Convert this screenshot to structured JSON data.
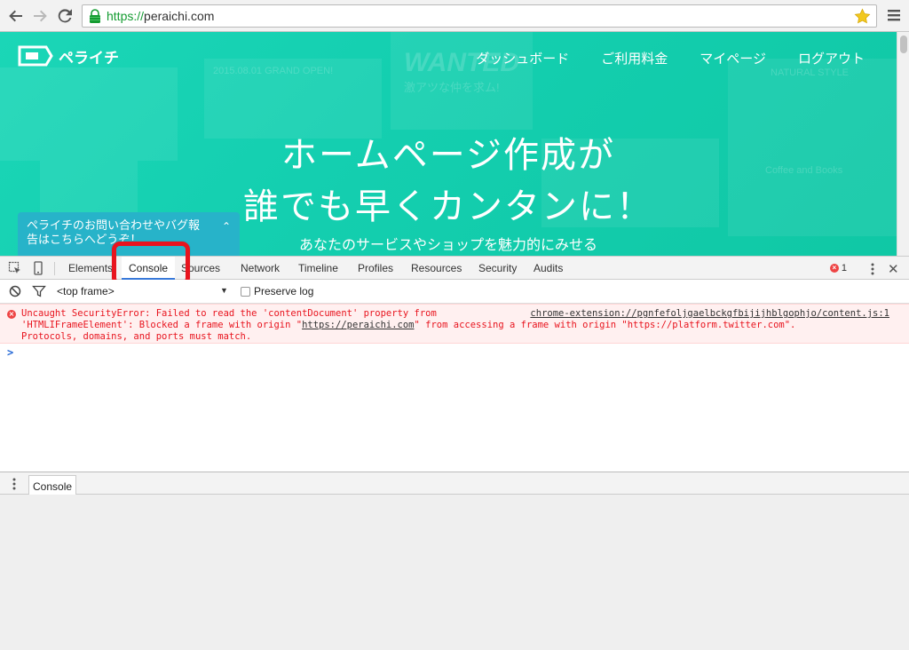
{
  "browser": {
    "url_scheme": "https://",
    "url_host": "peraichi.com"
  },
  "site": {
    "logo_text": "ペライチ",
    "nav": [
      "ダッシュボード",
      "ご利用料金",
      "マイページ",
      "ログアウト"
    ],
    "hero_line1": "ホームページ作成が",
    "hero_line2": "誰でも早くカンタンに！",
    "hero_sub": "あなたのサービスやショップを魅力的にみせる",
    "help_line1": "ペライチのお問い合わせやバグ報",
    "help_line2": "告はこちらへどうぞ！",
    "bg_text": [
      "2015.08.01 GRAND OPEN!",
      "WANTED",
      "激アツな仲を求ム!",
      "NATURAL STYLE",
      "Coffee and Books"
    ]
  },
  "devtools": {
    "tabs": [
      "Elements",
      "Console",
      "Sources",
      "Network",
      "Timeline",
      "Profiles",
      "Resources",
      "Security",
      "Audits"
    ],
    "active_tab": "Console",
    "error_count": "1",
    "frame": "<top frame>",
    "preserve_log": "Preserve log",
    "error": {
      "line1": "Uncaught SecurityError: Failed to read the 'contentDocument' property from",
      "line2a": "'HTMLIFrameElement': Blocked a frame with origin \"",
      "line2_link": "https://peraichi.com",
      "line2b": "\" from accessing a frame with origin \"https://platform.twitter.com\".",
      "line3": "Protocols, domains, and ports must match.",
      "source": "chrome-extension://pgnfefoljgaelbckgfbijijhblgophjo/content.js:1"
    },
    "prompt": ">",
    "drawer_tab": "Console"
  },
  "colors": {
    "accent": "#1bd6b7",
    "highlight": "#e8141e",
    "error_text": "#e8141e",
    "active_tab_underline": "#3879d9"
  },
  "icons": [
    "back-arrow-icon",
    "forward-arrow-icon",
    "reload-icon",
    "lock-icon",
    "star-icon",
    "hamburger-menu-icon",
    "inspect-icon",
    "device-mode-icon",
    "clear-console-icon",
    "filter-icon",
    "error-icon",
    "more-icon",
    "close-icon"
  ]
}
